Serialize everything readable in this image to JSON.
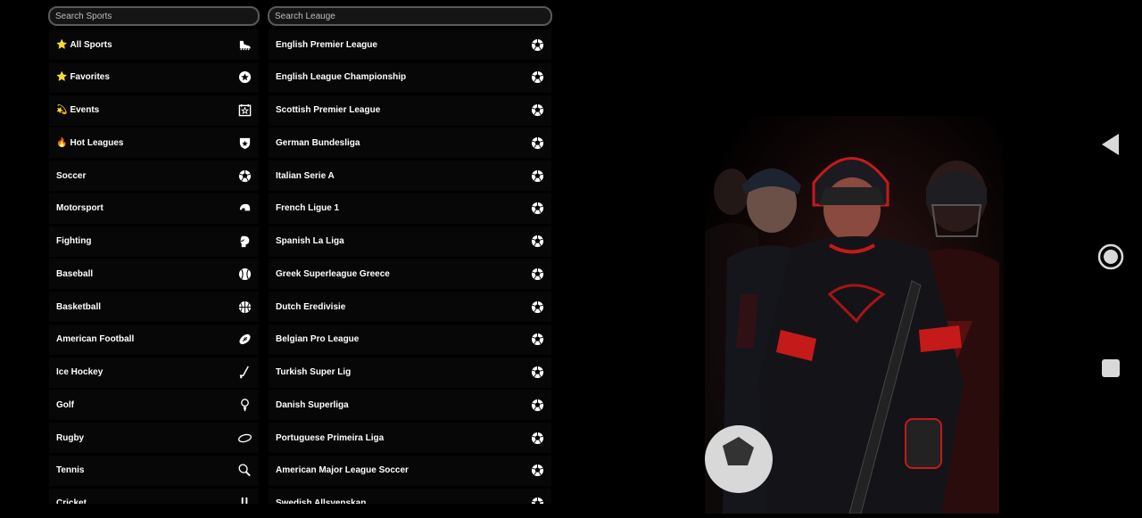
{
  "search": {
    "sports_placeholder": "Search Sports",
    "league_placeholder": "Search Leauge"
  },
  "sports": [
    {
      "emoji": "⭐",
      "label": "All Sports",
      "icon": "boot-icon"
    },
    {
      "emoji": "⭐",
      "label": "Favorites",
      "icon": "star-circle-icon"
    },
    {
      "emoji": "💫",
      "label": "Events",
      "icon": "star-calendar-icon"
    },
    {
      "emoji": "🔥",
      "label": "Hot Leagues",
      "icon": "shield-icon"
    },
    {
      "emoji": "",
      "label": "Soccer",
      "icon": "soccer-ball-icon"
    },
    {
      "emoji": "",
      "label": "Motorsport",
      "icon": "helmet-icon"
    },
    {
      "emoji": "",
      "label": "Fighting",
      "icon": "boxing-glove-icon"
    },
    {
      "emoji": "",
      "label": "Baseball",
      "icon": "baseball-icon"
    },
    {
      "emoji": "",
      "label": "Basketball",
      "icon": "basketball-icon"
    },
    {
      "emoji": "",
      "label": "American Football",
      "icon": "american-football-icon"
    },
    {
      "emoji": "",
      "label": "Ice Hockey",
      "icon": "hockey-stick-icon"
    },
    {
      "emoji": "",
      "label": "Golf",
      "icon": "golf-tee-icon"
    },
    {
      "emoji": "",
      "label": "Rugby",
      "icon": "rugby-ball-icon"
    },
    {
      "emoji": "",
      "label": "Tennis",
      "icon": "tennis-racket-icon"
    },
    {
      "emoji": "",
      "label": "Cricket",
      "icon": "cricket-icon"
    }
  ],
  "leagues": [
    {
      "label": "English Premier League",
      "icon": "soccer-ball-icon"
    },
    {
      "label": "English League Championship",
      "icon": "soccer-ball-icon"
    },
    {
      "label": "Scottish Premier League",
      "icon": "soccer-ball-icon"
    },
    {
      "label": "German Bundesliga",
      "icon": "soccer-ball-icon"
    },
    {
      "label": "Italian Serie A",
      "icon": "soccer-ball-icon"
    },
    {
      "label": "French Ligue 1",
      "icon": "soccer-ball-icon"
    },
    {
      "label": "Spanish La Liga",
      "icon": "soccer-ball-icon"
    },
    {
      "label": "Greek Superleague Greece",
      "icon": "soccer-ball-icon"
    },
    {
      "label": "Dutch Eredivisie",
      "icon": "soccer-ball-icon"
    },
    {
      "label": "Belgian Pro League",
      "icon": "soccer-ball-icon"
    },
    {
      "label": "Turkish Super Lig",
      "icon": "soccer-ball-icon"
    },
    {
      "label": "Danish Superliga",
      "icon": "soccer-ball-icon"
    },
    {
      "label": "Portuguese Primeira Liga",
      "icon": "soccer-ball-icon"
    },
    {
      "label": "American Major League Soccer",
      "icon": "soccer-ball-icon"
    },
    {
      "label": "Swedish Allsvenskan",
      "icon": "soccer-ball-icon"
    }
  ],
  "nav": {
    "back_icon": "back-triangle-icon",
    "home_icon": "home-circle-icon",
    "recents_icon": "recents-square-icon"
  },
  "colors": {
    "background": "#000000",
    "row_background": "#070707",
    "search_border": "#5a5a5a",
    "accent_red": "#d11a1a"
  }
}
